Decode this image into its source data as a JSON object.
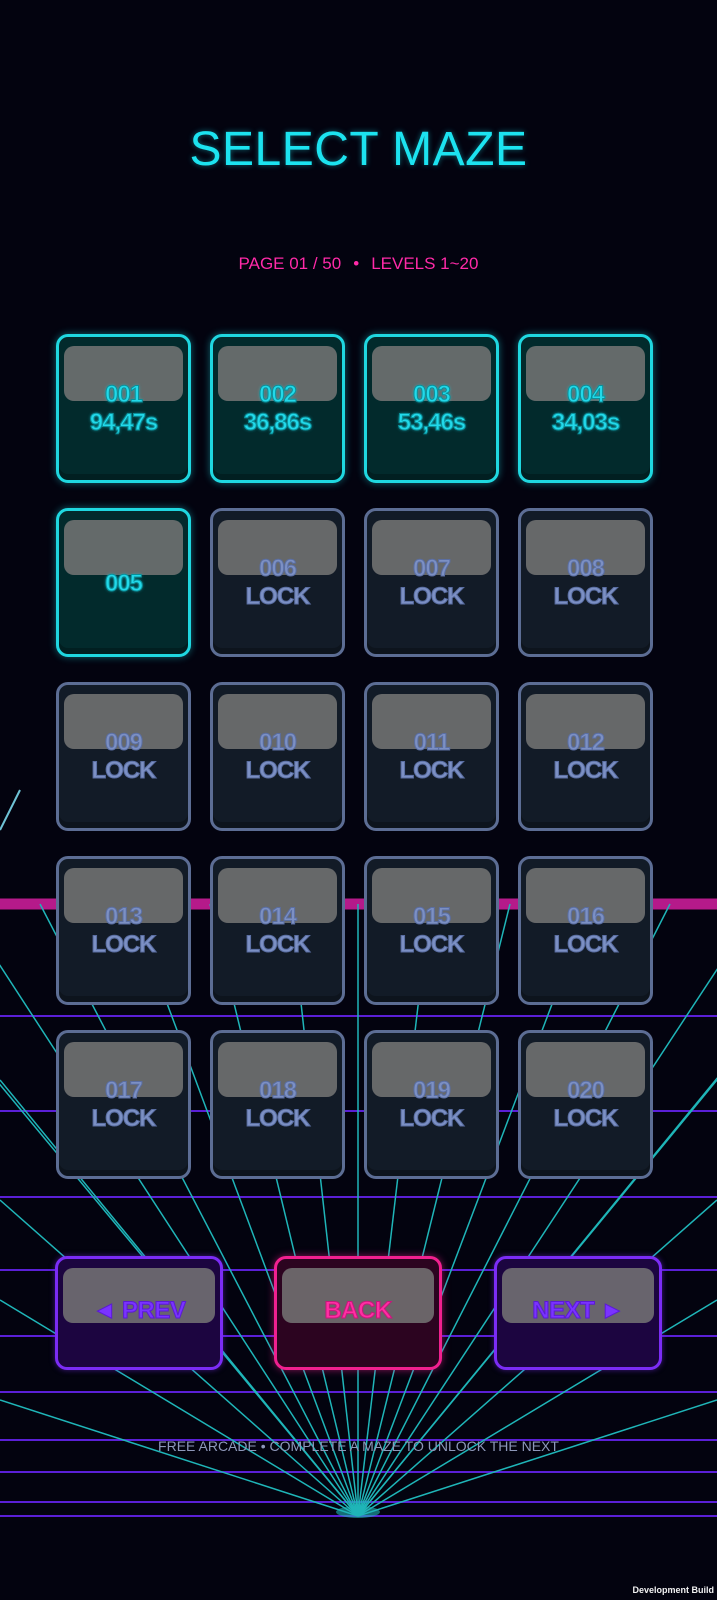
{
  "header": {
    "title": "SELECT MAZE",
    "page": "PAGE 01 / 50",
    "separator": "•",
    "levels": "LEVELS 1~20"
  },
  "levels": [
    {
      "number": "001",
      "value": "94,47s",
      "state": "unlocked"
    },
    {
      "number": "002",
      "value": "36,86s",
      "state": "unlocked"
    },
    {
      "number": "003",
      "value": "53,46s",
      "state": "unlocked"
    },
    {
      "number": "004",
      "value": "34,03s",
      "state": "unlocked"
    },
    {
      "number": "005",
      "value": "",
      "state": "unlocked"
    },
    {
      "number": "006",
      "value": "LOCK",
      "state": "locked"
    },
    {
      "number": "007",
      "value": "LOCK",
      "state": "locked"
    },
    {
      "number": "008",
      "value": "LOCK",
      "state": "locked"
    },
    {
      "number": "009",
      "value": "LOCK",
      "state": "locked"
    },
    {
      "number": "010",
      "value": "LOCK",
      "state": "locked"
    },
    {
      "number": "011",
      "value": "LOCK",
      "state": "locked"
    },
    {
      "number": "012",
      "value": "LOCK",
      "state": "locked"
    },
    {
      "number": "013",
      "value": "LOCK",
      "state": "locked"
    },
    {
      "number": "014",
      "value": "LOCK",
      "state": "locked"
    },
    {
      "number": "015",
      "value": "LOCK",
      "state": "locked"
    },
    {
      "number": "016",
      "value": "LOCK",
      "state": "locked"
    },
    {
      "number": "017",
      "value": "LOCK",
      "state": "locked"
    },
    {
      "number": "018",
      "value": "LOCK",
      "state": "locked"
    },
    {
      "number": "019",
      "value": "LOCK",
      "state": "locked"
    },
    {
      "number": "020",
      "value": "LOCK",
      "state": "locked"
    }
  ],
  "nav": {
    "prev_label": "◄ PREV",
    "back_label": "BACK",
    "next_label": "NEXT ►"
  },
  "footer": {
    "hint": "FREE ARCADE • COMPLETE A MAZE TO UNLOCK THE NEXT",
    "build": "Development Build"
  },
  "colors": {
    "background": "#03030f",
    "title_cyan": "#1ce3f0",
    "accent_pink": "#ff2aa8",
    "unlocked_border": "#1fd7e0",
    "locked_border": "#5c6d94",
    "nav_purple": "#7b2cf5",
    "grid_teal": "#1fb5b8",
    "grid_purple": "#5a1fd6",
    "horizon_magenta": "#b51a8a"
  }
}
